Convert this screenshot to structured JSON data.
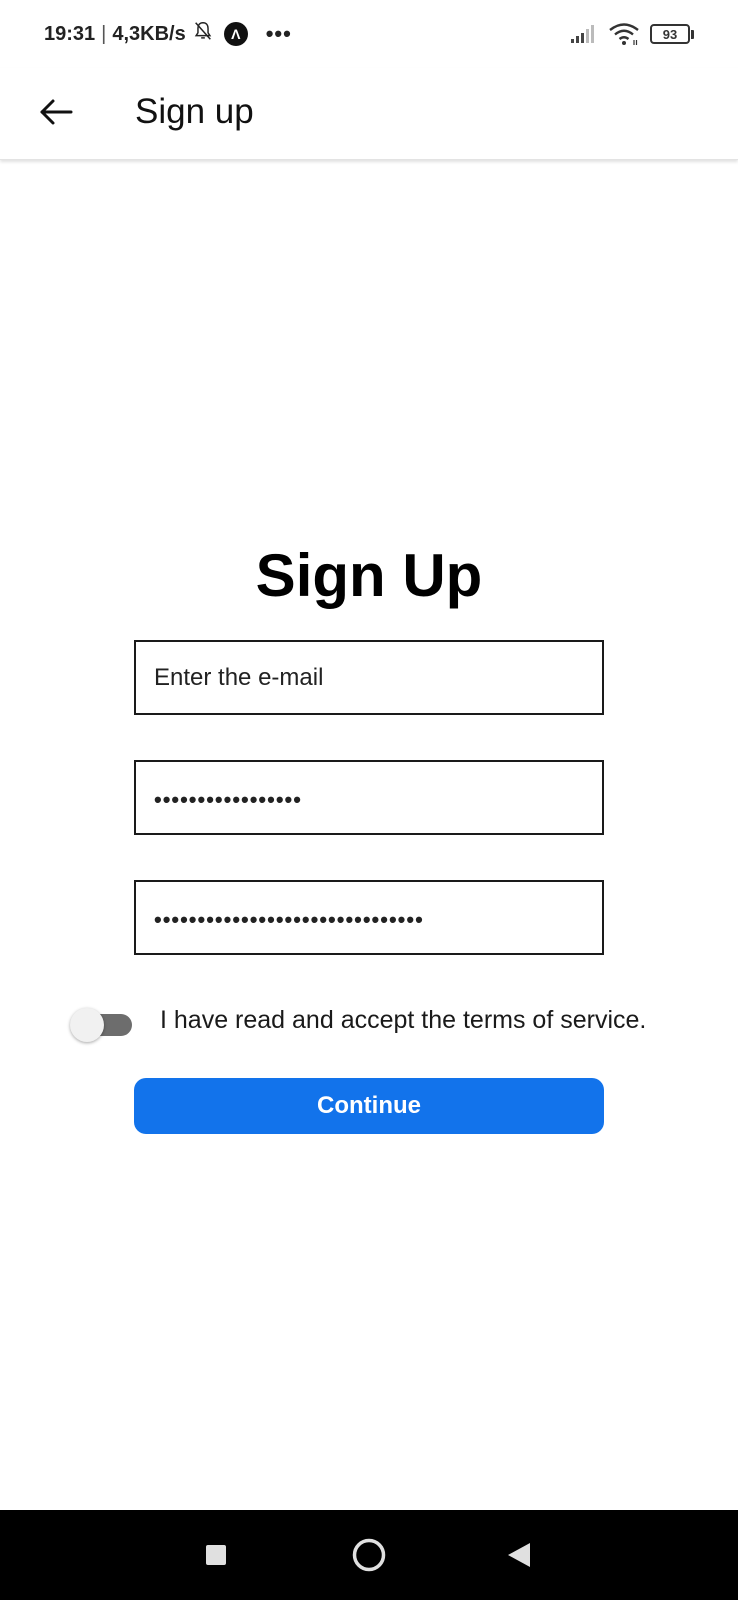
{
  "status_bar": {
    "time": "19:31",
    "separator": "|",
    "net_speed": "4,3KB/s",
    "app_badge": "Λ",
    "more": "•••",
    "battery_level": "93",
    "icons": [
      "bell-muted-icon",
      "signal-icon",
      "wifi-icon",
      "battery-icon"
    ]
  },
  "app_bar": {
    "title": "Sign up",
    "back_icon": "arrow-left-icon"
  },
  "form": {
    "heading": "Sign Up",
    "email": {
      "placeholder": "Enter the e-mail",
      "value": ""
    },
    "password": {
      "masked_value": "•••••••••••••••••"
    },
    "confirm_password": {
      "masked_value": "•••••••••••••••••••••••••••••••"
    },
    "terms": {
      "label": "I have read and accept the terms of service.",
      "checked": false
    },
    "continue_label": "Continue"
  },
  "colors": {
    "primary": "#1273eb",
    "toggle_track": "#6d6d6d",
    "nav_bar": "#000000"
  },
  "nav_bar": {
    "icons": [
      "recent-apps-icon",
      "home-icon",
      "back-triangle-icon"
    ]
  }
}
